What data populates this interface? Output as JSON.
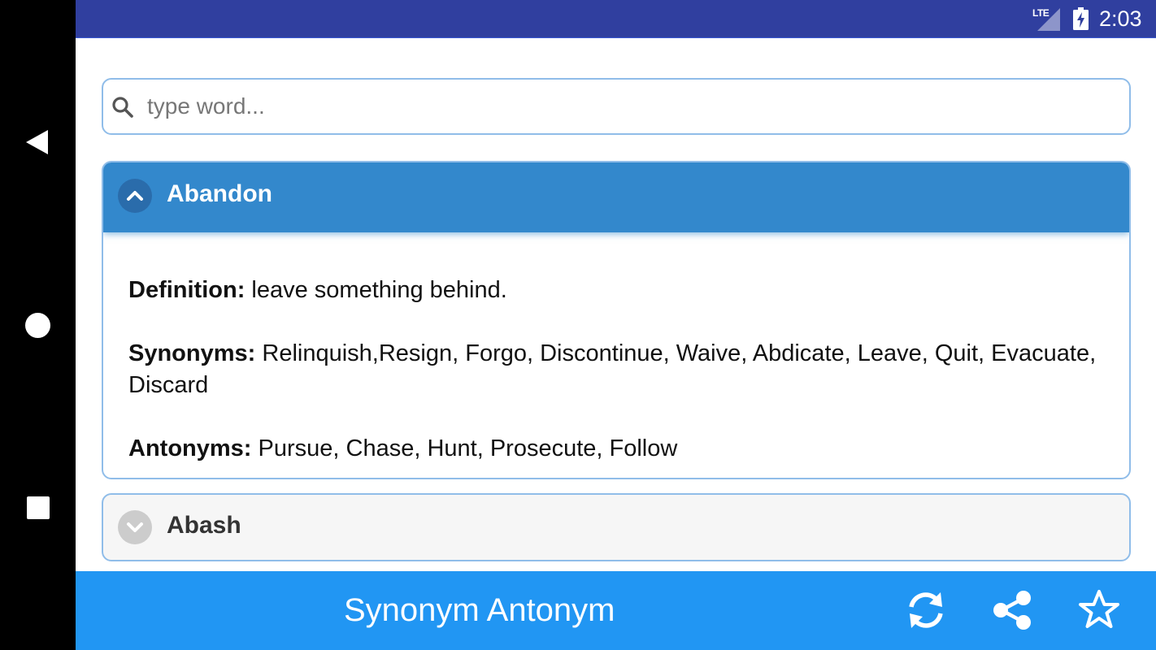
{
  "status_bar": {
    "network": "LTE",
    "time": "2:03"
  },
  "search": {
    "placeholder": "type word...",
    "value": ""
  },
  "entries": [
    {
      "word": "Abandon",
      "expanded": true,
      "definition_label": "Definition:",
      "definition": "leave something behind.",
      "synonyms_label": "Synonyms:",
      "synonyms": "Relinquish,Resign, Forgo, Discontinue, Waive, Abdicate, Leave, Quit, Evacuate, Discard",
      "antonyms_label": "Antonyms:",
      "antonyms": "Pursue, Chase, Hunt, Prosecute, Follow"
    },
    {
      "word": "Abash",
      "expanded": false
    }
  ],
  "bottom_bar": {
    "title": "Synonym Antonym",
    "icons": [
      "refresh-icon",
      "share-icon",
      "star-icon"
    ]
  },
  "nav_bar": {
    "icons": [
      "back-icon",
      "home-icon",
      "recents-icon"
    ]
  },
  "colors": {
    "status_bar": "#303f9f",
    "bottom_bar": "#2196f3",
    "open_header": "#3388cc",
    "panel_border": "#90bde9"
  }
}
